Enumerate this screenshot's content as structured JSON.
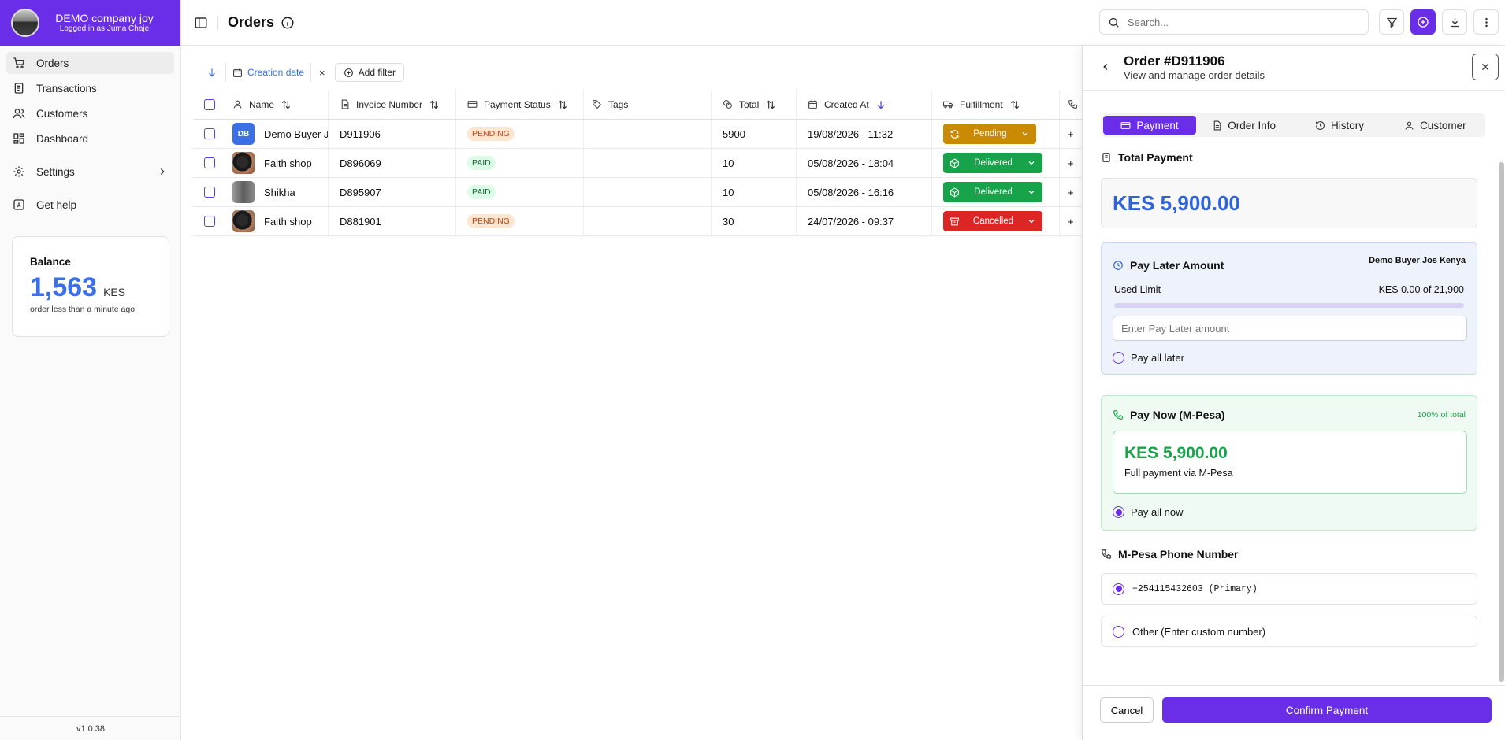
{
  "sidebar": {
    "company": "DEMO company joy",
    "logged_in": "Logged in as Juma Chaje",
    "items": [
      {
        "label": "Orders",
        "icon": "cart-icon"
      },
      {
        "label": "Transactions",
        "icon": "receipt-icon"
      },
      {
        "label": "Customers",
        "icon": "users-icon"
      },
      {
        "label": "Dashboard",
        "icon": "grid-icon"
      },
      {
        "label": "Settings",
        "icon": "gear-icon"
      },
      {
        "label": "Get help",
        "icon": "help-icon"
      }
    ],
    "balance": {
      "title": "Balance",
      "value": "1,563",
      "currency": "KES",
      "subtitle": "order less than a minute ago"
    },
    "version": "v1.0.38"
  },
  "header": {
    "title": "Orders",
    "search_placeholder": "Search..."
  },
  "filters": {
    "active": "Creation date",
    "remove": "×",
    "add": "Add filter"
  },
  "table": {
    "columns": {
      "name": "Name",
      "invoice": "Invoice Number",
      "payment_status": "Payment Status",
      "tags": "Tags",
      "total": "Total",
      "created": "Created At",
      "fulfillment": "Fulfillment"
    },
    "rows": [
      {
        "initials": "DB",
        "name": "Demo Buyer J",
        "invoice": "D911906",
        "status": "PENDING",
        "tags": "",
        "total": "5900",
        "created": "19/08/2026 - 11:32",
        "fulfillment": "Pending",
        "extra": "+"
      },
      {
        "initials": "",
        "name": "Faith shop",
        "invoice": "D896069",
        "status": "PAID",
        "tags": "",
        "total": "10",
        "created": "05/08/2026 - 18:04",
        "fulfillment": "Delivered",
        "extra": "+"
      },
      {
        "initials": "",
        "name": "Shikha",
        "invoice": "D895907",
        "status": "PAID",
        "tags": "",
        "total": "10",
        "created": "05/08/2026 - 16:16",
        "fulfillment": "Delivered",
        "extra": "+"
      },
      {
        "initials": "",
        "name": "Faith shop",
        "invoice": "D881901",
        "status": "PENDING",
        "tags": "",
        "total": "30",
        "created": "24/07/2026 - 09:37",
        "fulfillment": "Cancelled",
        "extra": "+"
      }
    ]
  },
  "panel": {
    "title": "Order #D911906",
    "subtitle": "View and manage order details",
    "tabs": [
      "Payment",
      "Order Info",
      "History",
      "Customer"
    ],
    "total_payment": {
      "label": "Total Payment",
      "value": "KES 5,900.00"
    },
    "pay_later": {
      "title": "Pay Later Amount",
      "buyer": "Demo Buyer Jos Kenya",
      "used_label": "Used Limit",
      "used_value": "KES 0.00 of 21,900",
      "used_fraction": 0.0,
      "input_placeholder": "Enter Pay Later amount",
      "radio_label": "Pay all later"
    },
    "pay_now": {
      "title": "Pay Now (M-Pesa)",
      "percent": "100% of total",
      "value": "KES 5,900.00",
      "subtitle": "Full payment via M-Pesa",
      "radio_label": "Pay all now"
    },
    "phone": {
      "label": "M-Pesa Phone Number",
      "primary": "+254115432603 (Primary)",
      "other": "Other (Enter custom number)"
    },
    "cancel_label": "Cancel",
    "confirm_label": "Confirm Payment"
  },
  "colors": {
    "accent": "#6a2ee8",
    "blue": "#2f63d8",
    "green": "#16a34a",
    "pending": "#ca8a04",
    "cancelled": "#dc2626"
  }
}
